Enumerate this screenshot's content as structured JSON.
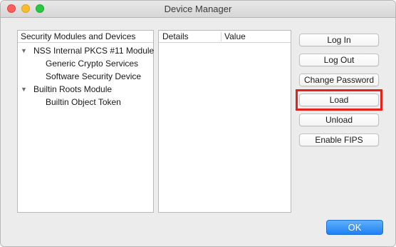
{
  "window": {
    "title": "Device Manager"
  },
  "tree": {
    "header": "Security Modules and Devices",
    "items": [
      {
        "label": "NSS Internal PKCS #11 Module",
        "expanded": true
      },
      {
        "label": "Generic Crypto Services"
      },
      {
        "label": "Software Security Device"
      },
      {
        "label": "Builtin Roots Module",
        "expanded": true
      },
      {
        "label": "Builtin Object Token"
      }
    ]
  },
  "details": {
    "columns": [
      "Details",
      "Value"
    ]
  },
  "buttons": {
    "log_in": "Log In",
    "log_out": "Log Out",
    "change_password": "Change Password",
    "load": "Load",
    "unload": "Unload",
    "enable_fips": "Enable FIPS",
    "ok": "OK"
  },
  "icons": {
    "expand": "▼"
  },
  "colors": {
    "highlight": "#e8201b",
    "ok_button": "#1f80f5"
  }
}
